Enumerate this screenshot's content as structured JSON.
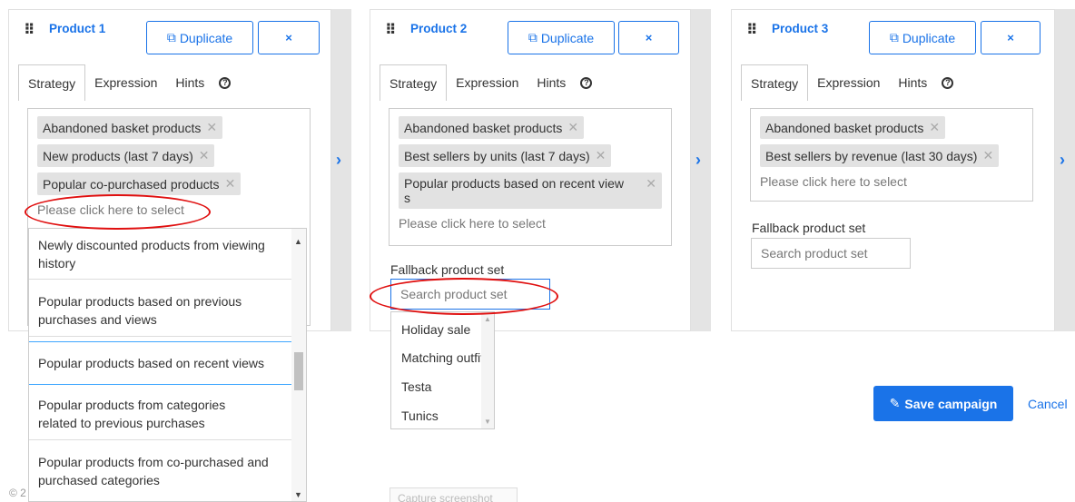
{
  "products": [
    {
      "title": "Product 1",
      "duplicate_label": "Duplicate",
      "close_label": "×",
      "tabs": [
        "Strategy",
        "Expression",
        "Hints"
      ],
      "chips": [
        "Abandoned basket products",
        "New products (last 7 days)",
        "Popular co-purchased products"
      ],
      "placeholder": "Please click here to select"
    },
    {
      "title": "Product 2",
      "duplicate_label": "Duplicate",
      "close_label": "×",
      "tabs": [
        "Strategy",
        "Expression",
        "Hints"
      ],
      "chips": [
        "Abandoned basket products",
        "Best sellers by units (last 7 days)",
        "Popular products based on recent view",
        "s"
      ],
      "placeholder": "Please click here to select",
      "fallback_label": "Fallback product set",
      "fallback_placeholder": "Search product set"
    },
    {
      "title": "Product 3",
      "duplicate_label": "Duplicate",
      "close_label": "×",
      "tabs": [
        "Strategy",
        "Expression",
        "Hints"
      ],
      "chips": [
        "Abandoned basket products",
        "Best sellers by revenue (last 30 days)"
      ],
      "placeholder": "Please click here to select",
      "fallback_label": "Fallback product set",
      "fallback_placeholder": "Search product set"
    }
  ],
  "strategy_dropdown": [
    [
      "Newly discounted products from viewing",
      "history"
    ],
    [
      "Popular products based on previous",
      "purchases and views"
    ],
    [
      "Popular products based on recent views"
    ],
    [
      "Popular products from categories",
      "related to previous purchases"
    ],
    [
      "Popular products from co-purchased and",
      "purchased categories"
    ]
  ],
  "fallback_dropdown": [
    "Holiday sale",
    "Matching outfit",
    "Testa",
    "Tunics"
  ],
  "footer": {
    "save_label": "Save campaign",
    "cancel_label": "Cancel",
    "copyright": "© 2",
    "capture_label": "Capture screenshot"
  },
  "colors": {
    "accent": "#1a73e8",
    "annotation": "#e01010",
    "chip": "#e2e2e2"
  },
  "icons": {
    "drag": "drag-handle-icon",
    "duplicate": "duplicate-icon",
    "help": "help-circle-icon",
    "next": "chevron-right-icon",
    "save": "edit-icon"
  }
}
